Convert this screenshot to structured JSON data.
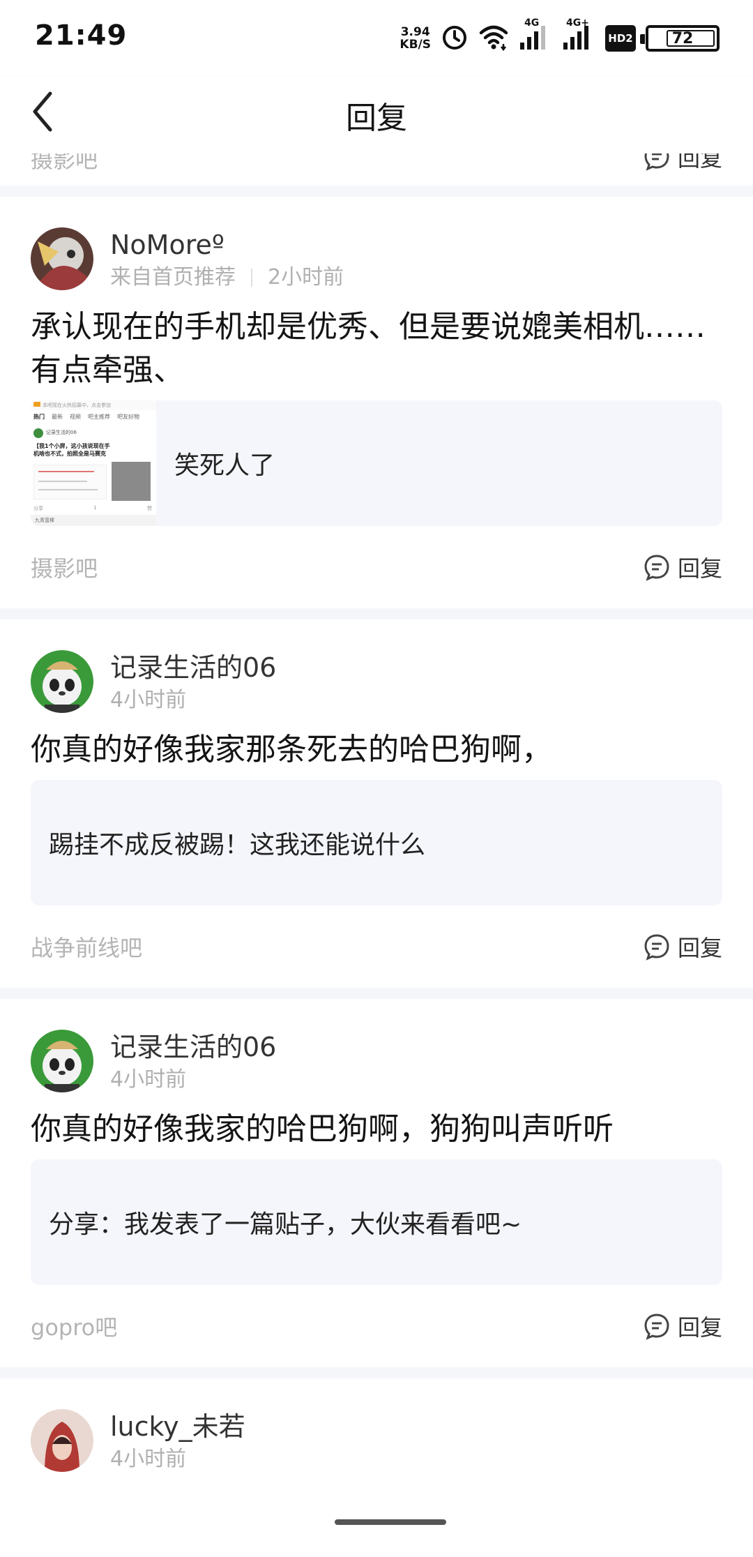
{
  "status_bar": {
    "time": "21:49",
    "speed_value": "3.94",
    "speed_unit": "KB/S",
    "net1": "4G",
    "net2": "4G+",
    "hd": "HD2",
    "battery": "72"
  },
  "nav": {
    "title": "回复"
  },
  "partial_card": {
    "forum": "摄影吧",
    "reply_label": "回复"
  },
  "replies": [
    {
      "username": "NoMoreº",
      "source": "来自首页推荐",
      "time": "2小时前",
      "content": "承认现在的手机却是优秀、但是要说媲美相机……有点牵强、",
      "quote": "笑死人了",
      "thumb": {
        "top_banner": "本吧现在火热招募中，点击参加",
        "tabs": [
          "热门",
          "最新",
          "视频",
          "吧主推荐",
          "吧友好物"
        ],
        "author": "记录生活的06",
        "post_title": "【我1个小屏，这小孩说现在手机啥也不式，拍照全是马赛克",
        "actions": [
          "分享",
          "1",
          "赞"
        ],
        "footer": "九青蛮棒"
      },
      "forum": "摄影吧",
      "reply_label": "回复"
    },
    {
      "username": "记录生活的06",
      "time": "4小时前",
      "content": "你真的好像我家那条死去的哈巴狗啊，",
      "quote": "踢挂不成反被踢！这我还能说什么",
      "forum": "战争前线吧",
      "reply_label": "回复"
    },
    {
      "username": "记录生活的06",
      "time": "4小时前",
      "content": "你真的好像我家的哈巴狗啊，狗狗叫声听听",
      "quote": "分享：我发表了一篇贴子，大伙来看看吧~",
      "forum": "gopro吧",
      "reply_label": "回复"
    },
    {
      "username": "lucky_未若",
      "time": "4小时前"
    }
  ],
  "colors": {
    "accent_text": "#141414",
    "muted_text": "#b0b0b0",
    "quote_bg": "#f5f6fc",
    "separator": "#f5f6fa"
  }
}
